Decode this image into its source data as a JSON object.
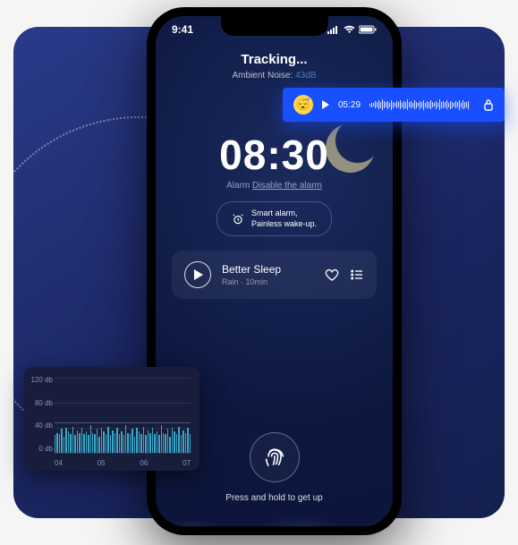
{
  "status_bar": {
    "time": "9:41"
  },
  "header": {
    "title": "Tracking...",
    "noise_label": "Ambient Noise:",
    "noise_value": "43dB"
  },
  "clock": {
    "time": "08:30",
    "alarm_label": "Alarm",
    "alarm_action": "Disable the alarm"
  },
  "smart": {
    "line1": "Smart alarm,",
    "line2": "Painless wake-up."
  },
  "track": {
    "title": "Better Sleep",
    "subtitle": "Rain · 10min"
  },
  "bottom": {
    "label": "Press and hold to get up"
  },
  "audio_overlay": {
    "time": "05:29"
  },
  "chart_data": {
    "type": "bar",
    "ylabel": "db",
    "y_ticks": [
      "120 db",
      "80 db",
      "40 db",
      "0 db"
    ],
    "x_ticks": [
      "04",
      "05",
      "06",
      "07"
    ],
    "ylim": [
      0,
      120
    ],
    "values": [
      28,
      32,
      30,
      38,
      26,
      40,
      34,
      30,
      42,
      28,
      36,
      32,
      40,
      30,
      34,
      28,
      44,
      32,
      30,
      38,
      26,
      40,
      34,
      30,
      42,
      28,
      36,
      32,
      40,
      30,
      34,
      28,
      44,
      32,
      30,
      38,
      26,
      40,
      34,
      30,
      42,
      28,
      36,
      32,
      40,
      30,
      34,
      28,
      44,
      32,
      30,
      38,
      26,
      40,
      34,
      30,
      42,
      28,
      36,
      32,
      40,
      30
    ]
  }
}
